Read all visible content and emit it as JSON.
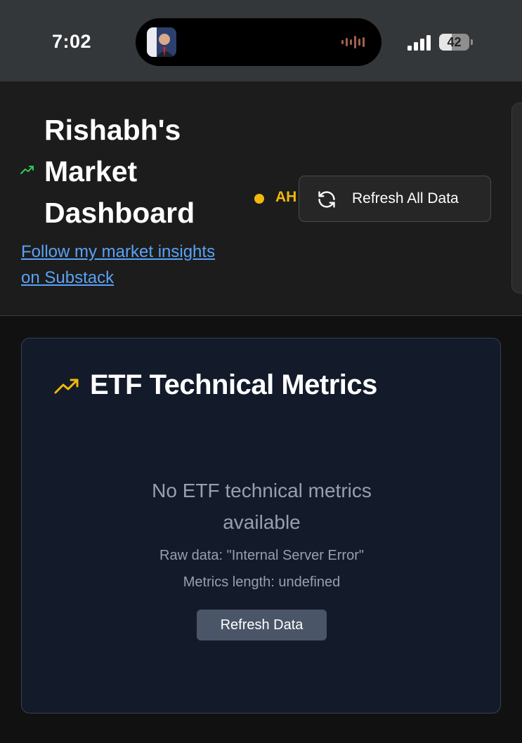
{
  "status_bar": {
    "time": "7:02",
    "battery_percent": "42",
    "battery_level": 0.42,
    "signal_bars": 4
  },
  "header": {
    "title": "Rishabh's Market Dashboard",
    "link_text": "Follow my market insights on Substack",
    "status_label": "AH",
    "status_color": "#f0b90b",
    "refresh_all_label": "Refresh All Data",
    "trend_icon": "trending-up-icon",
    "trend_icon_color": "#34c759"
  },
  "card": {
    "title": "ETF Technical Metrics",
    "title_icon": "trending-up-icon",
    "title_icon_color": "#f0b90b",
    "empty_message": "No ETF technical metrics available",
    "raw_data_text": "Raw data: \"Internal Server Error\"",
    "metrics_length_text": "Metrics length: undefined",
    "refresh_label": "Refresh Data"
  },
  "colors": {
    "accent_link": "#5aa2f5",
    "card_background": "#131a2a",
    "button_secondary": "#4a5567"
  }
}
